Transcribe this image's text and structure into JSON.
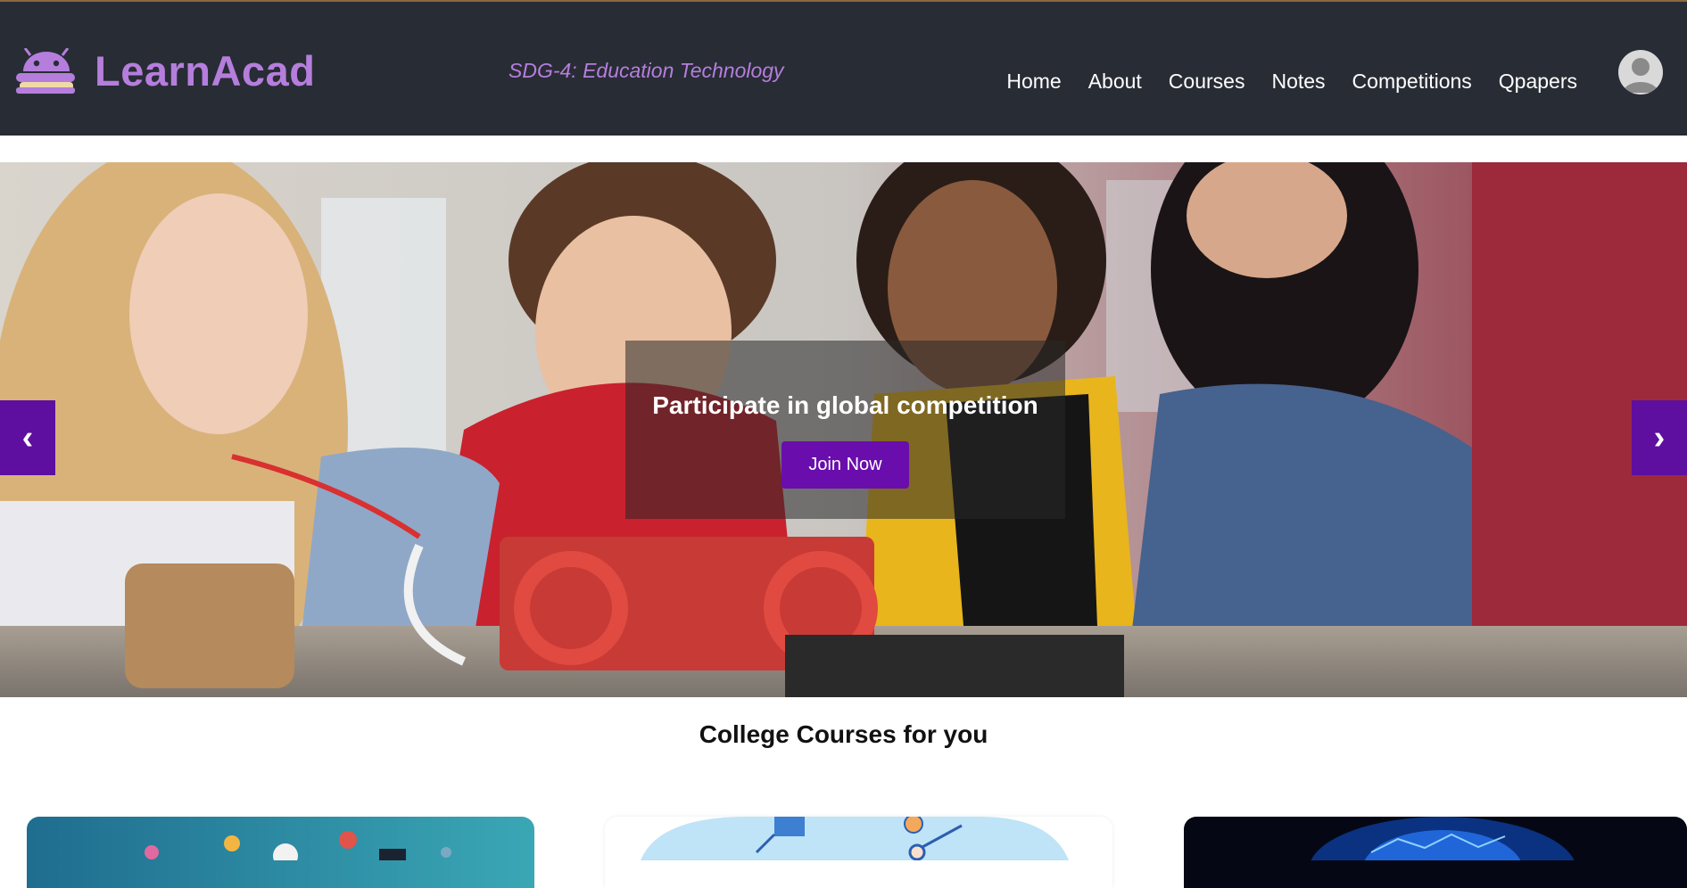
{
  "brand": {
    "name": "LearnAcad",
    "logo_icon": "android-book-icon"
  },
  "tagline": "SDG-4: Education Technology",
  "nav": {
    "items": [
      {
        "label": "Home"
      },
      {
        "label": "About"
      },
      {
        "label": "Courses"
      },
      {
        "label": "Notes"
      },
      {
        "label": "Competitions"
      },
      {
        "label": "Qpapers"
      }
    ],
    "avatar_icon": "user-avatar-icon"
  },
  "hero": {
    "caption_title": "Participate in global competition",
    "cta_label": "Join Now",
    "prev_label": "‹",
    "next_label": "›"
  },
  "section": {
    "title": "College Courses for you"
  },
  "colors": {
    "header_bg": "#282c35",
    "accent": "#b57edc",
    "button": "#6a0dad"
  }
}
